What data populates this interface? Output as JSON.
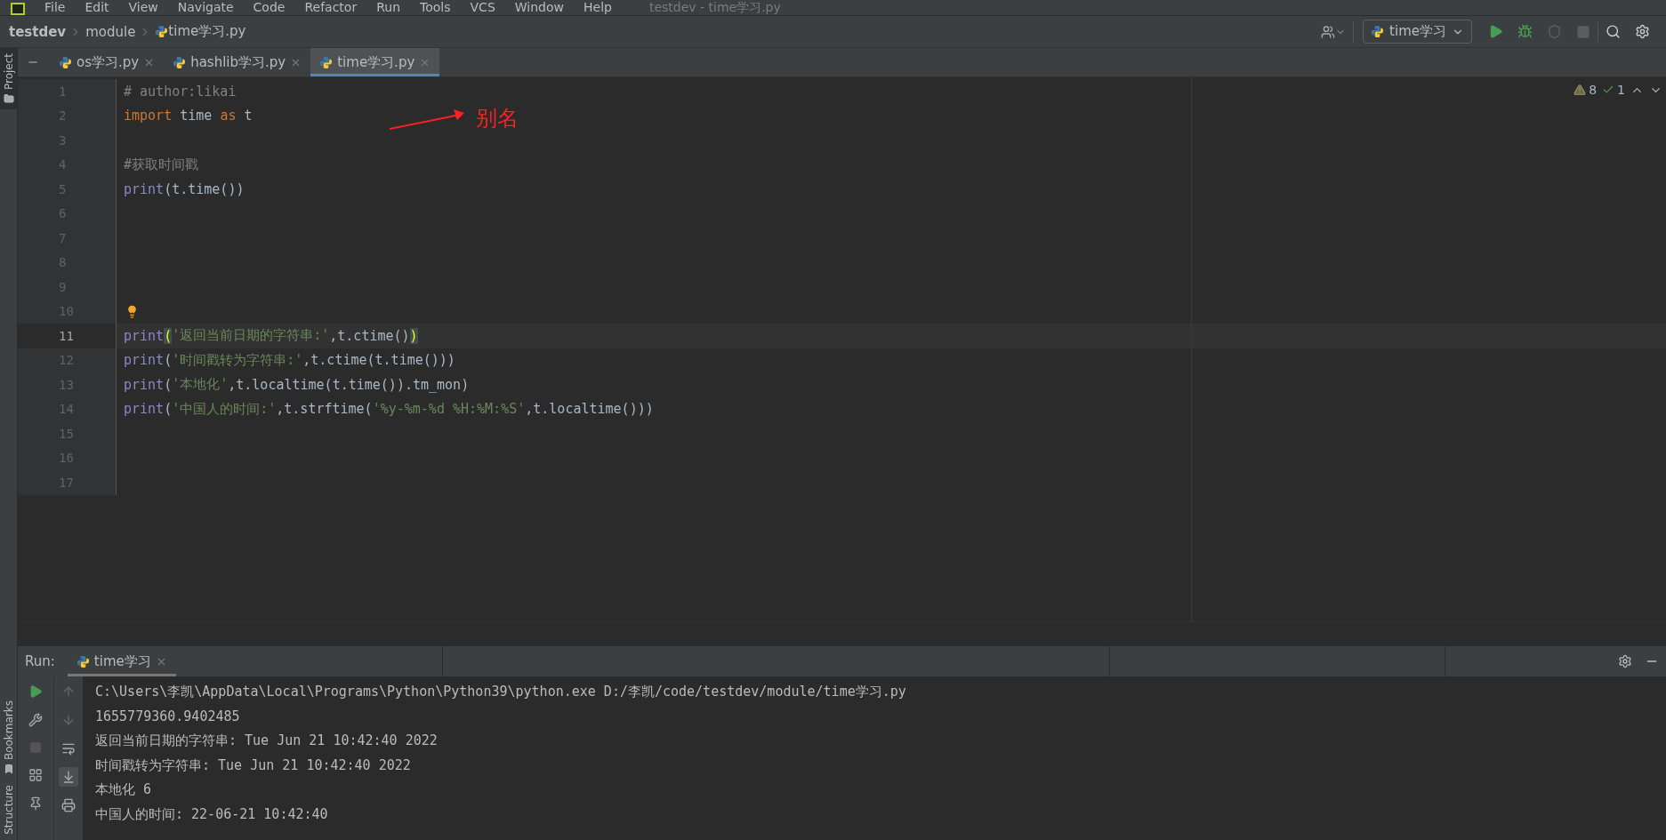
{
  "menu": [
    "File",
    "Edit",
    "View",
    "Navigate",
    "Code",
    "Refactor",
    "Run",
    "Tools",
    "VCS",
    "Window",
    "Help"
  ],
  "window": {
    "title": "testdev - time学习.py"
  },
  "breadcrumbs": [
    "testdev",
    "module",
    "time学习.py"
  ],
  "run_config": {
    "label": "time学习"
  },
  "side_tabs": {
    "top": "Project",
    "bottom": [
      "Bookmarks",
      "Structure"
    ]
  },
  "tabs": [
    {
      "label": "os学习.py",
      "selected": false
    },
    {
      "label": "hashlib学习.py",
      "selected": false
    },
    {
      "label": "time学习.py",
      "selected": true
    }
  ],
  "inspections": {
    "warnings": "8",
    "typos": "1"
  },
  "editor": {
    "lines": [
      {
        "number": "1",
        "current": false,
        "segments": [
          {
            "text": "# author:likai",
            "kind": "comment"
          }
        ]
      },
      {
        "number": "2",
        "current": false,
        "segments": [
          {
            "text": "import",
            "kind": "keyword"
          },
          {
            "text": " time ",
            "kind": "plain"
          },
          {
            "text": "as",
            "kind": "keyword"
          },
          {
            "text": " t",
            "kind": "plain"
          }
        ]
      },
      {
        "number": "3",
        "current": false
      },
      {
        "number": "4",
        "current": false,
        "segments": [
          {
            "text": "#获取时间戳",
            "kind": "comment"
          }
        ]
      },
      {
        "number": "5",
        "current": false,
        "segments": [
          {
            "text": "print",
            "kind": "builtin"
          },
          {
            "text": "(t.time())",
            "kind": "plain"
          }
        ]
      },
      {
        "number": "6",
        "current": false
      },
      {
        "number": "7",
        "current": false
      },
      {
        "number": "8",
        "current": false
      },
      {
        "number": "9",
        "current": false
      },
      {
        "number": "10",
        "current": false,
        "bulb": true
      },
      {
        "number": "11",
        "current": true,
        "segments": [
          {
            "text": "print",
            "kind": "builtin"
          },
          {
            "text": "(",
            "kind": "match"
          },
          {
            "text": "'返回当前日期的字符串:'",
            "kind": "string"
          },
          {
            "text": ",t.ctime()",
            "kind": "plain"
          },
          {
            "text": ")",
            "kind": "match"
          }
        ]
      },
      {
        "number": "12",
        "current": false,
        "segments": [
          {
            "text": "print",
            "kind": "builtin"
          },
          {
            "text": "(",
            "kind": "plain"
          },
          {
            "text": "'时间戳转为字符串:'",
            "kind": "string"
          },
          {
            "text": ",t.ctime(t.time()))",
            "kind": "plain"
          }
        ]
      },
      {
        "number": "13",
        "current": false,
        "segments": [
          {
            "text": "print",
            "kind": "builtin"
          },
          {
            "text": "(",
            "kind": "plain"
          },
          {
            "text": "'本地化'",
            "kind": "string"
          },
          {
            "text": ",t.localtime(t.time()).tm_mon)",
            "kind": "plain"
          }
        ]
      },
      {
        "number": "14",
        "current": false,
        "segments": [
          {
            "text": "print",
            "kind": "builtin"
          },
          {
            "text": "(",
            "kind": "plain"
          },
          {
            "text": "'中国人的时间:'",
            "kind": "string"
          },
          {
            "text": ",t.strftime(",
            "kind": "plain"
          },
          {
            "text": "'%y-%m-%d %H:%M:%S'",
            "kind": "string"
          },
          {
            "text": ",t.localtime()))",
            "kind": "plain"
          }
        ]
      },
      {
        "number": "15",
        "current": false
      },
      {
        "number": "16",
        "current": false
      },
      {
        "number": "17",
        "current": false
      }
    ]
  },
  "annotation": {
    "text": "别名"
  },
  "run": {
    "label": "Run:",
    "tab": "time学习",
    "output": [
      "C:\\Users\\李凯\\AppData\\Local\\Programs\\Python\\Python39\\python.exe D:/李凯/code/testdev/module/time学习.py",
      "1655779360.9402485",
      "返回当前日期的字符串: Tue Jun 21 10:42:40 2022",
      "时间戳转为字符串: Tue Jun 21 10:42:40 2022",
      "本地化 6",
      "中国人的时间: 22-06-21 10:42:40"
    ]
  }
}
